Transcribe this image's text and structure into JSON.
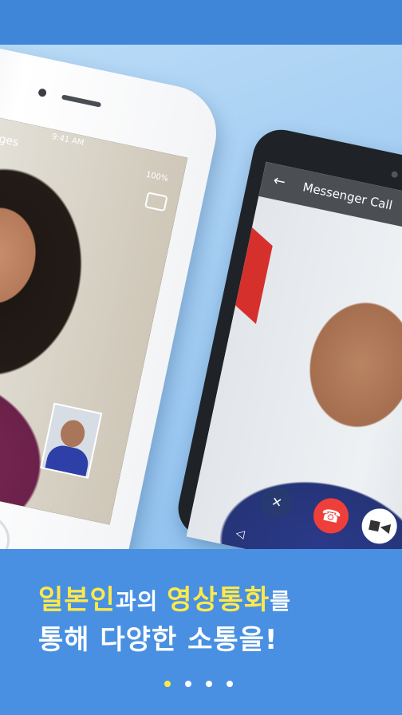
{
  "iphone": {
    "back_label": "Messages",
    "time": "9:41 AM",
    "battery": "100%"
  },
  "android": {
    "title": "Messenger Call"
  },
  "headline": {
    "line1_parts": [
      "일본인",
      "과의 ",
      "영상통화",
      "를"
    ],
    "line2": "통해 다양한 소통을!"
  },
  "pagination": {
    "pages": 4,
    "active": 1
  },
  "colors": {
    "highlight": "#ffe94a",
    "end_call": "#ee3f3a",
    "band": "#4990e2"
  }
}
